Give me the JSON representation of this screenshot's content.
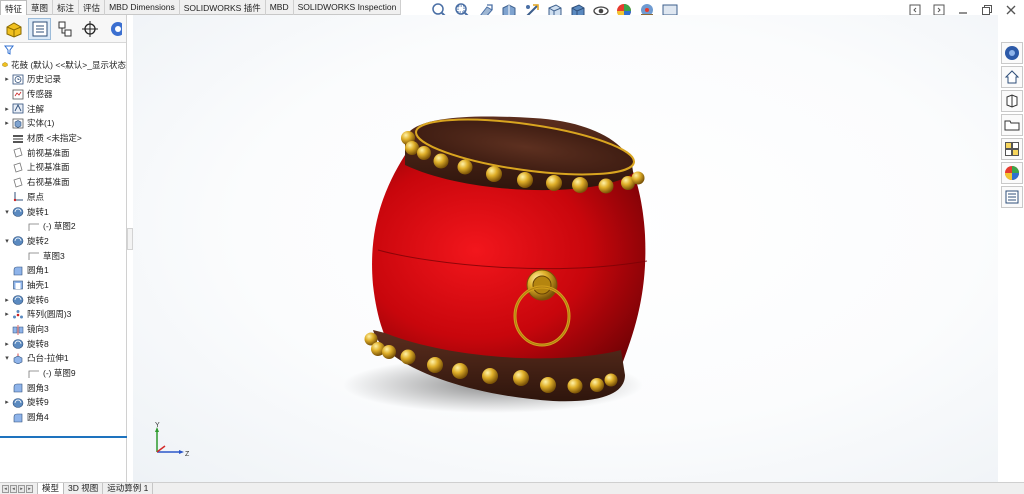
{
  "command_tabs": [
    "特征",
    "草图",
    "标注",
    "评估",
    "MBD Dimensions",
    "SOLIDWORKS 插件",
    "MBD",
    "SOLIDWORKS Inspection"
  ],
  "active_command_tab": "特征",
  "hud_icons": [
    "zoom-to-fit-icon",
    "zoom-area-icon",
    "previous-view-icon",
    "section-view-icon",
    "dynamic-annotation-icon",
    "view-orientation-icon",
    "display-style-icon",
    "hide-show-items-icon",
    "edit-appearance-icon",
    "apply-scene-icon",
    "view-settings-icon"
  ],
  "feature_tree": {
    "root": "花鼓 (默认) <<默认>_显示状态",
    "items": [
      {
        "label": "历史记录",
        "icon": "history-icon",
        "arrow": "▸",
        "indent": 0
      },
      {
        "label": "传感器",
        "icon": "sensor-icon",
        "arrow": "",
        "indent": 0
      },
      {
        "label": "注解",
        "icon": "annotation-icon",
        "arrow": "▸",
        "indent": 0
      },
      {
        "label": "实体(1)",
        "icon": "solid-body-icon",
        "arrow": "▸",
        "indent": 0
      },
      {
        "label": "材质 <未指定>",
        "icon": "material-icon",
        "arrow": "",
        "indent": 0
      },
      {
        "label": "前视基准面",
        "icon": "plane-icon",
        "arrow": "",
        "indent": 0
      },
      {
        "label": "上视基准面",
        "icon": "plane-icon",
        "arrow": "",
        "indent": 0
      },
      {
        "label": "右视基准面",
        "icon": "plane-icon",
        "arrow": "",
        "indent": 0
      },
      {
        "label": "原点",
        "icon": "origin-icon",
        "arrow": "",
        "indent": 0
      },
      {
        "label": "旋转1",
        "icon": "revolve-icon",
        "arrow": "▾",
        "indent": 0
      },
      {
        "label": "(-) 草图2",
        "icon": "sketch-icon",
        "arrow": "",
        "indent": 1
      },
      {
        "label": "旋转2",
        "icon": "revolve-icon",
        "arrow": "▾",
        "indent": 0
      },
      {
        "label": "草图3",
        "icon": "sketch-icon",
        "arrow": "",
        "indent": 1
      },
      {
        "label": "圆角1",
        "icon": "fillet-icon",
        "arrow": "",
        "indent": 0
      },
      {
        "label": "抽壳1",
        "icon": "shell-icon",
        "arrow": "",
        "indent": 0
      },
      {
        "label": "旋转6",
        "icon": "revolve-icon",
        "arrow": "▸",
        "indent": 0
      },
      {
        "label": "阵列(圆周)3",
        "icon": "circular-pattern-icon",
        "arrow": "▸",
        "indent": 0
      },
      {
        "label": "镜向3",
        "icon": "mirror-icon",
        "arrow": "",
        "indent": 0
      },
      {
        "label": "旋转8",
        "icon": "revolve-icon",
        "arrow": "▸",
        "indent": 0
      },
      {
        "label": "凸台-拉伸1",
        "icon": "extrude-icon",
        "arrow": "▾",
        "indent": 0
      },
      {
        "label": "(-) 草图9",
        "icon": "sketch-icon",
        "arrow": "",
        "indent": 1
      },
      {
        "label": "圆角3",
        "icon": "fillet-icon",
        "arrow": "",
        "indent": 0
      },
      {
        "label": "旋转9",
        "icon": "revolve-icon",
        "arrow": "▸",
        "indent": 0
      },
      {
        "label": "圆角4",
        "icon": "fillet-icon",
        "arrow": "",
        "indent": 0
      }
    ]
  },
  "bottom_tabs": [
    "模型",
    "3D 视图",
    "运动算例 1"
  ],
  "active_bottom_tab": "模型",
  "triad_labels": {
    "y": "Y",
    "z": "Z"
  },
  "colors": {
    "drum_red": "#c8060c",
    "drum_brown": "#4a2418",
    "brass": "#d9a520",
    "accent_blue": "#1e73be"
  }
}
